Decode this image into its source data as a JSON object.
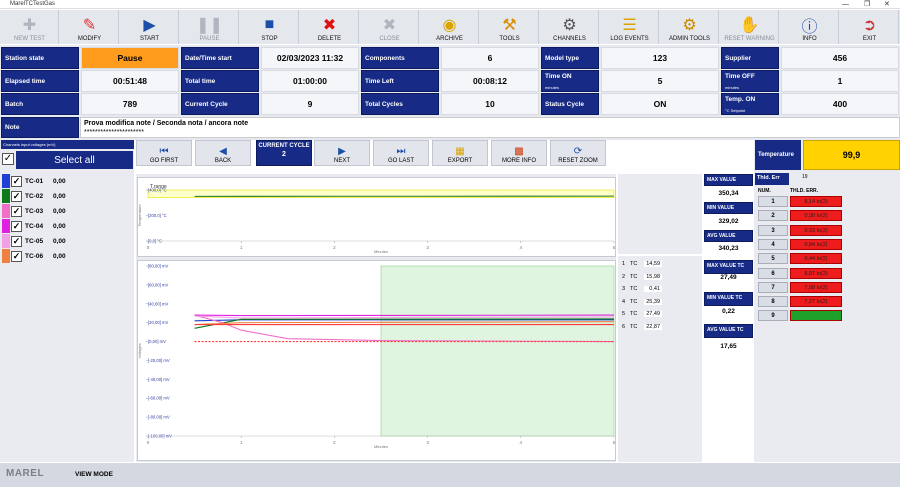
{
  "window": {
    "title": "MarelTCTestGas"
  },
  "toolbar": {
    "buttons": [
      {
        "label": "NEW TEST",
        "icon": "plus-icon",
        "enabled": false
      },
      {
        "label": "MODIFY",
        "icon": "pencil-icon",
        "enabled": true
      },
      {
        "label": "START",
        "icon": "play-icon",
        "enabled": true
      },
      {
        "label": "PAUSE",
        "icon": "pause-icon",
        "enabled": false
      },
      {
        "label": "STOP",
        "icon": "stop-icon",
        "enabled": true
      },
      {
        "label": "DELETE",
        "icon": "delete-icon",
        "enabled": true
      },
      {
        "label": "CLOSE",
        "icon": "close-icon",
        "enabled": false
      },
      {
        "label": "ARCHIVE",
        "icon": "archive-icon",
        "enabled": true
      },
      {
        "label": "TOOLS",
        "icon": "wrench-icon",
        "enabled": true
      },
      {
        "label": "CHANNELS",
        "icon": "gear-icon",
        "enabled": true
      },
      {
        "label": "LOG EVENTS",
        "icon": "clipboard-icon",
        "enabled": true
      },
      {
        "label": "ADMIN TOOLS",
        "icon": "admin-gear-icon",
        "enabled": true
      },
      {
        "label": "RESET WARNING",
        "icon": "hand-icon",
        "enabled": false
      },
      {
        "label": "INFO",
        "icon": "info-icon",
        "enabled": true
      },
      {
        "label": "EXIT",
        "icon": "exit-icon",
        "enabled": true
      }
    ]
  },
  "info": {
    "station_state_label": "Station state",
    "station_state": "Pause",
    "elapsed_label": "Elapsed time",
    "elapsed": "00:51:48",
    "batch_label": "Batch",
    "batch": "789",
    "datetime_start_label": "Date/Time start",
    "datetime_start": "02/03/2023 11:32",
    "total_time_label": "Total time",
    "total_time": "01:00:00",
    "current_cycle_label": "Current Cycle",
    "current_cycle": "9",
    "components_label": "Components",
    "components": "6",
    "time_left_label": "Time Left",
    "time_left": "00:08:12",
    "total_cycles_label": "Total Cycles",
    "total_cycles": "10",
    "model_type_label": "Model type",
    "model_type": "123",
    "time_on_label": "Time ON",
    "time_on_unit": "minutes",
    "time_on": "5",
    "status_cycle_label": "Status Cycle",
    "status_cycle": "ON",
    "supplier_label": "Supplier",
    "supplier": "456",
    "time_off_label": "Time OFF",
    "time_off_unit": "minutes",
    "time_off": "1",
    "temp_on_label": "Temp. ON",
    "temp_on_unit": "°C Setpoint",
    "temp_on": "400",
    "note_label": "Note",
    "note_line1": "Prova modifica note / Seconda nota / ancora note",
    "note_line2": "**********************"
  },
  "left": {
    "channels_hint": "Channels input voltages (mV)",
    "select_all": "Select all",
    "channels": [
      {
        "name": "TC-01",
        "value": "0,00",
        "color": "#1f3fd4"
      },
      {
        "name": "TC-02",
        "value": "0,00",
        "color": "#0f7a1a"
      },
      {
        "name": "TC-03",
        "value": "0,00",
        "color": "#f070c8"
      },
      {
        "name": "TC-04",
        "value": "0,00",
        "color": "#e020e0"
      },
      {
        "name": "TC-05",
        "value": "0,00",
        "color": "#f2a0e6"
      },
      {
        "name": "TC-06",
        "value": "0,00",
        "color": "#f08040"
      }
    ]
  },
  "nav": {
    "go_first": "GO FIRST",
    "back": "BACK",
    "current_cycle_label": "CURRENT CYCLE",
    "current_cycle": "2",
    "next": "NEXT",
    "go_last": "GO LAST",
    "export": "EXPORT",
    "more_info": "MORE INFO",
    "reset_zoom": "RESET ZOOM"
  },
  "chart_data": [
    {
      "type": "line",
      "legend": "T.range",
      "ylabel": "Temperature",
      "xlabel": "Minutes",
      "x_ticks": [
        "0",
        "1",
        "2",
        "3",
        "4",
        "5"
      ],
      "y_ticks": [
        "[400,0] °C",
        "[200,0] °C",
        "[0,0] °C"
      ],
      "ylim": [
        0,
        400
      ],
      "xlim": [
        0,
        5
      ],
      "series": [
        {
          "color": "#1f7a1f",
          "points": [
            [
              0.5,
              350
            ],
            [
              1,
              350.5
            ],
            [
              2,
              351
            ],
            [
              3,
              351
            ],
            [
              4,
              351.5
            ],
            [
              5,
              352
            ]
          ]
        }
      ],
      "band": {
        "color": "#ffffcc",
        "y_min": 340,
        "y_max": 400
      }
    },
    {
      "type": "line",
      "ylabel": "Voltages",
      "xlabel": "Minutes",
      "x_ticks": [
        "0",
        "1",
        "2",
        "3",
        "4",
        "5"
      ],
      "y_ticks": [
        "[80,00] mV",
        "[60,00] mV",
        "[40,00] mV",
        "[20,00] mV",
        "[0,00] mV",
        "[-20,00] mV",
        "[-40,00] mV",
        "[-60,00] mV",
        "[-80,00] mV",
        "[-100,00] mV"
      ],
      "ylim": [
        -100,
        80
      ],
      "xlim": [
        0,
        5
      ],
      "highlight_x": [
        2.5,
        5
      ],
      "series": [
        {
          "color": "#1f3fd4",
          "points": [
            [
              0.5,
              22
            ],
            [
              1,
              23
            ],
            [
              5,
              23
            ]
          ]
        },
        {
          "color": "#0f7a1a",
          "points": [
            [
              0.5,
              14
            ],
            [
              1,
              23.5
            ],
            [
              5,
              24
            ]
          ]
        },
        {
          "color": "#f070c8",
          "points": [
            [
              0.5,
              28
            ],
            [
              0.8,
              20
            ],
            [
              1,
              12
            ],
            [
              1.5,
              3
            ],
            [
              2.5,
              1
            ],
            [
              5,
              0
            ]
          ]
        },
        {
          "color": "#e020e0",
          "points": [
            [
              0.5,
              28
            ],
            [
              1,
              27.5
            ],
            [
              5,
              28
            ]
          ]
        },
        {
          "color": "#f2a0e6",
          "points": [
            [
              0.5,
              27
            ],
            [
              1,
              25
            ],
            [
              5,
              26
            ]
          ]
        },
        {
          "color": "#f08040",
          "points": [
            [
              0.5,
              18
            ],
            [
              1,
              20
            ],
            [
              5,
              21
            ]
          ]
        },
        {
          "color": "#ff3b3b",
          "points": [
            [
              0.5,
              0
            ],
            [
              5,
              0
            ]
          ],
          "dashed": true
        },
        {
          "color": "#ff3b3b",
          "points": [
            [
              0.5,
              18
            ],
            [
              5,
              18
            ]
          ]
        }
      ]
    }
  ],
  "tc_values": [
    {
      "num": "1",
      "tc": "TC",
      "val": "14,59"
    },
    {
      "num": "2",
      "tc": "TC",
      "val": "15,98"
    },
    {
      "num": "3",
      "tc": "TC",
      "val": "0,41"
    },
    {
      "num": "4",
      "tc": "TC",
      "val": "25,39"
    },
    {
      "num": "5",
      "tc": "TC",
      "val": "27,49"
    },
    {
      "num": "6",
      "tc": "TC",
      "val": "22,87"
    }
  ],
  "stats": {
    "max_value_label": "MAX VALUE",
    "max_value": "350,34",
    "min_value_label": "MIN VALUE",
    "min_value": "329,02",
    "avg_value_label": "AVG VALUE",
    "avg_value": "340,23",
    "max_tc_label": "MAX VALUE TC",
    "max_tc": "27,49",
    "min_tc_label": "MIN VALUE TC",
    "min_tc": "0,22",
    "avg_tc_label": "AVG VALUE TC",
    "avg_tc": "17,65"
  },
  "right": {
    "temperature_label": "Temperature",
    "temperature": "99,9",
    "thld_err_label": "Thld. Err",
    "thld_err_value": "19",
    "num_header": "NUM.",
    "thld_header": "THLD. ERR.",
    "rows": [
      {
        "num": "1",
        "val": "8,14 lo(2)",
        "status": "error"
      },
      {
        "num": "2",
        "val": "0,30 lo(2)",
        "status": "error"
      },
      {
        "num": "3",
        "val": "0,93 lo(2)",
        "status": "error"
      },
      {
        "num": "4",
        "val": "0,84 lo(2)",
        "status": "error"
      },
      {
        "num": "5",
        "val": "0,44 lo(2)",
        "status": "error"
      },
      {
        "num": "6",
        "val": "8,97 lo(2)",
        "status": "error"
      },
      {
        "num": "7",
        "val": "7,98 lo(2)",
        "status": "error"
      },
      {
        "num": "8",
        "val": "7,27 lo(2)",
        "status": "error"
      },
      {
        "num": "9",
        "val": "",
        "status": "ok"
      }
    ],
    "colors": {
      "error": "#ee1c1c",
      "ok": "#1fa02a"
    }
  },
  "status_bar": {
    "logo": "MAREL",
    "mode": "VIEW MODE"
  }
}
